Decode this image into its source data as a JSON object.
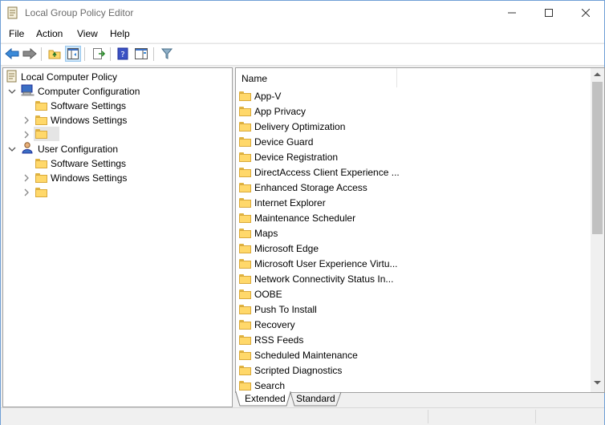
{
  "window": {
    "title": "Local Group Policy Editor",
    "controls": {
      "minimize": "—",
      "maximize": "☐",
      "close": "✕"
    }
  },
  "menu": [
    "File",
    "Action",
    "View",
    "Help"
  ],
  "toolbar": {
    "icons": [
      "back-arrow-icon",
      "forward-arrow-icon",
      "up-folder-icon",
      "show-hide-tree-icon",
      "export-list-icon",
      "help-icon",
      "properties-pane-icon",
      "filter-icon"
    ]
  },
  "tree": {
    "root": "Local Computer Policy",
    "computer_configuration": "Computer Configuration",
    "computer_children": [
      "Software Settings",
      "Windows Settings",
      ""
    ],
    "user_configuration": "User Configuration",
    "user_children": [
      "Software Settings",
      "Windows Settings",
      ""
    ]
  },
  "list": {
    "column_name": "Name",
    "items": [
      "App-V",
      "App Privacy",
      "Delivery Optimization",
      "Device Guard",
      "Device Registration",
      "DirectAccess Client Experience ...",
      "Enhanced Storage Access",
      "Internet Explorer",
      "Maintenance Scheduler",
      "Maps",
      "Microsoft Edge",
      "Microsoft User Experience Virtu...",
      "Network Connectivity Status In...",
      "OOBE",
      "Push To Install",
      "Recovery",
      "RSS Feeds",
      "Scheduled Maintenance",
      "Scripted Diagnostics",
      "Search"
    ]
  },
  "tabs": {
    "extended": "Extended",
    "standard": "Standard"
  }
}
